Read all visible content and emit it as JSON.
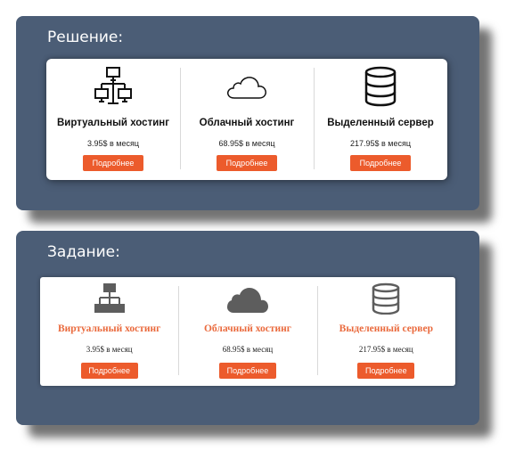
{
  "solution": {
    "title": "Решение:",
    "items": [
      {
        "name": "Виртуальный хостинг",
        "price": "3.95$ в месяц",
        "button": "Подробнее",
        "icon": "network-icon"
      },
      {
        "name": "Облачный хостинг",
        "price": "68.95$ в месяц",
        "button": "Подробнее",
        "icon": "cloud-icon"
      },
      {
        "name": "Выделенный сервер",
        "price": "217.95$ в месяц",
        "button": "Подробнее",
        "icon": "database-icon"
      }
    ]
  },
  "task": {
    "title": "Задание:",
    "items": [
      {
        "name": "Виртуальный хостинг",
        "price": "3.95$ в месяц",
        "button": "Подробнее",
        "icon": "network-icon"
      },
      {
        "name": "Облачный хостинг",
        "price": "68.95$ в месяц",
        "button": "Подробнее",
        "icon": "cloud-icon"
      },
      {
        "name": "Выделенный сервер",
        "price": "217.95$ в месяц",
        "button": "Подробнее",
        "icon": "database-icon"
      }
    ]
  },
  "colors": {
    "panel": "#4b5d76",
    "accent": "#ec5b2c",
    "task_title": "#ea6a3d",
    "task_icon": "#5d5d5d"
  }
}
